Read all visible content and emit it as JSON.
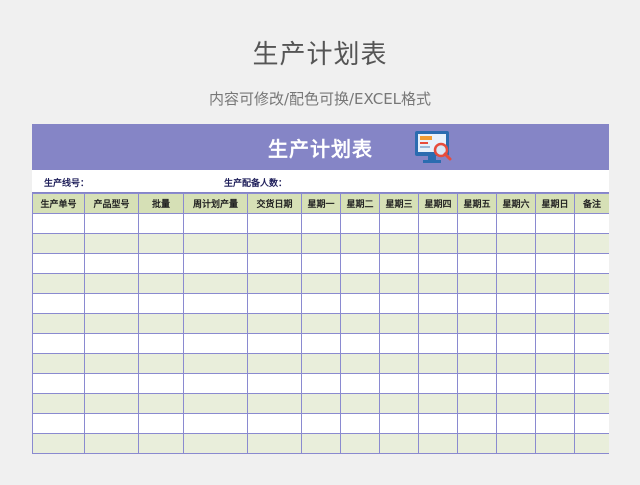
{
  "page": {
    "title": "生产计划表",
    "subtitle": "内容可修改/配色可换/EXCEL格式"
  },
  "sheet": {
    "banner_title": "生产计划表",
    "banner_icon": "monitor-magnifier-icon",
    "info": {
      "line_label": "生产线号：",
      "people_label": "生产配备人数："
    },
    "columns": [
      "生产单号",
      "产品型号",
      "批量",
      "周计划产量",
      "交货日期",
      "星期一",
      "星期二",
      "星期三",
      "星期四",
      "星期五",
      "星期六",
      "星期日",
      "备注"
    ],
    "empty_row_count": 13
  },
  "colors": {
    "banner": "#8585c6",
    "header_row": "#d6e0b6",
    "stripe": "#e9eedb",
    "grid": "#8a8ad0"
  }
}
